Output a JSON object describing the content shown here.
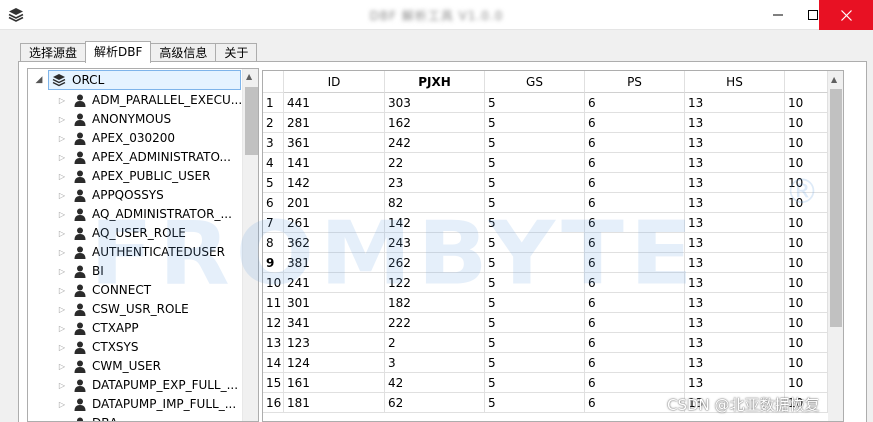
{
  "window": {
    "title": "DBF 解析工具 V1.0.0",
    "minimize_glyph": "—",
    "maximize_glyph": "☐",
    "close_glyph": "✕"
  },
  "tabs": [
    {
      "label": "选择源盘",
      "active": false
    },
    {
      "label": "解析DBF",
      "active": true
    },
    {
      "label": "高级信息",
      "active": false
    },
    {
      "label": "关于",
      "active": false
    }
  ],
  "tree": {
    "root": {
      "label": "ORCL",
      "icon": "database-icon",
      "expanded": true
    },
    "items": [
      "ADM_PARALLEL_EXECU...",
      "ANONYMOUS",
      "APEX_030200",
      "APEX_ADMINISTRATO...",
      "APEX_PUBLIC_USER",
      "APPQOSSYS",
      "AQ_ADMINISTRATOR_...",
      "AQ_USER_ROLE",
      "AUTHENTICATEDUSER",
      "BI",
      "CONNECT",
      "CSW_USR_ROLE",
      "CTXAPP",
      "CTXSYS",
      "CWM_USER",
      "DATAPUMP_EXP_FULL_...",
      "DATAPUMP_IMP_FULL_...",
      "DBA"
    ],
    "item_icon": "user-icon"
  },
  "grid": {
    "columns": [
      "ID",
      "PJXH",
      "GS",
      "PS",
      "HS",
      ""
    ],
    "bold_column": "PJXH",
    "bold_row": "9",
    "rows": [
      {
        "n": "1",
        "cells": [
          "441",
          "303",
          "5",
          "6",
          "13",
          "10"
        ]
      },
      {
        "n": "2",
        "cells": [
          "281",
          "162",
          "5",
          "6",
          "13",
          "10"
        ]
      },
      {
        "n": "3",
        "cells": [
          "361",
          "242",
          "5",
          "6",
          "13",
          "10"
        ]
      },
      {
        "n": "4",
        "cells": [
          "141",
          "22",
          "5",
          "6",
          "13",
          "10"
        ]
      },
      {
        "n": "5",
        "cells": [
          "142",
          "23",
          "5",
          "6",
          "13",
          "10"
        ]
      },
      {
        "n": "6",
        "cells": [
          "201",
          "82",
          "5",
          "6",
          "13",
          "10"
        ]
      },
      {
        "n": "7",
        "cells": [
          "261",
          "142",
          "5",
          "6",
          "13",
          "10"
        ]
      },
      {
        "n": "8",
        "cells": [
          "362",
          "243",
          "5",
          "6",
          "13",
          "10"
        ]
      },
      {
        "n": "9",
        "cells": [
          "381",
          "262",
          "5",
          "6",
          "13",
          "10"
        ]
      },
      {
        "n": "10",
        "cells": [
          "241",
          "122",
          "5",
          "6",
          "13",
          "10"
        ]
      },
      {
        "n": "11",
        "cells": [
          "301",
          "182",
          "5",
          "6",
          "13",
          "10"
        ]
      },
      {
        "n": "12",
        "cells": [
          "341",
          "222",
          "5",
          "6",
          "13",
          "10"
        ]
      },
      {
        "n": "13",
        "cells": [
          "123",
          "2",
          "5",
          "6",
          "13",
          "10"
        ]
      },
      {
        "n": "14",
        "cells": [
          "124",
          "3",
          "5",
          "6",
          "13",
          "10"
        ]
      },
      {
        "n": "15",
        "cells": [
          "161",
          "42",
          "5",
          "6",
          "13",
          "10"
        ]
      },
      {
        "n": "16",
        "cells": [
          "181",
          "62",
          "5",
          "6",
          "13",
          "10"
        ]
      }
    ]
  },
  "watermarks": {
    "logo": "FROMBYTE",
    "registered": "®",
    "credit": "CSDN @北亚数据恢复"
  },
  "colors": {
    "selection_bg": "#e5f3ff",
    "selection_border": "#7eb4ea",
    "close_button": "#e81123",
    "watermark": "#64a0e1"
  }
}
